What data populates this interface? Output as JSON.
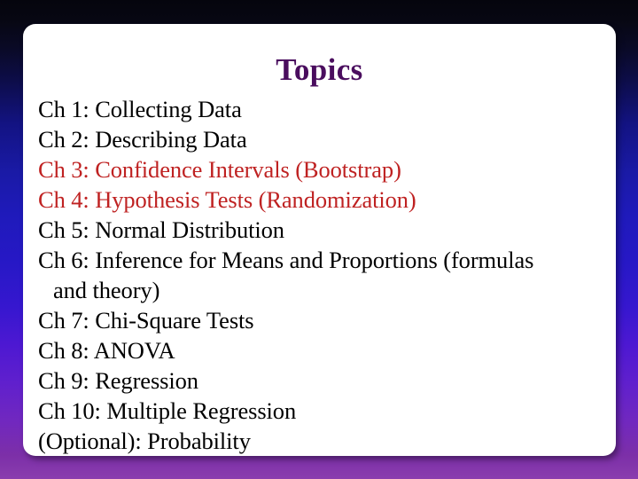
{
  "slide": {
    "title": "Topics",
    "title_color": "#4A0D5E",
    "body_color": "#000000",
    "accent_color": "#BF2222",
    "card_color": "#FFFFFF",
    "background_gradient": [
      "#05050D",
      "#0D0D4A",
      "#1A1AA6",
      "#2718C6",
      "#6020CD",
      "#8A3DAE"
    ]
  },
  "topics": [
    {
      "text": "Ch 1: Collecting Data",
      "color": "default",
      "continuation": ""
    },
    {
      "text": "Ch 2: Describing Data",
      "color": "default",
      "continuation": ""
    },
    {
      "text": "Ch 3: Confidence Intervals (Bootstrap)",
      "color": "accent",
      "continuation": ""
    },
    {
      "text": "Ch 4: Hypothesis Tests (Randomization)",
      "color": "accent",
      "continuation": ""
    },
    {
      "text": "Ch 5: Normal Distribution",
      "color": "default",
      "continuation": ""
    },
    {
      "text": "Ch 6: Inference for Means and Proportions (formulas",
      "color": "default",
      "continuation": "and theory)"
    },
    {
      "text": "Ch 7: Chi-Square Tests",
      "color": "default",
      "continuation": ""
    },
    {
      "text": "Ch 8: ANOVA",
      "color": "default",
      "continuation": ""
    },
    {
      "text": "Ch 9: Regression",
      "color": "default",
      "continuation": ""
    },
    {
      "text": "Ch 10: Multiple Regression",
      "color": "default",
      "continuation": ""
    },
    {
      "text": "(Optional): Probability",
      "color": "default",
      "continuation": ""
    }
  ]
}
